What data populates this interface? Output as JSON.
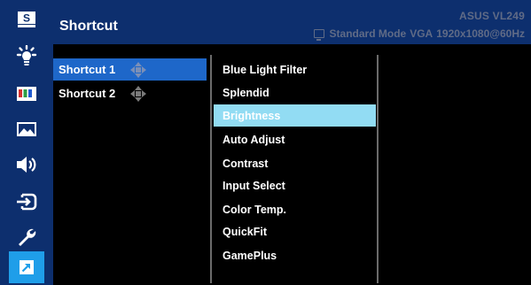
{
  "header": {
    "title": "Shortcut",
    "model": "ASUS  VL249",
    "mode": "Standard Mode",
    "input": "VGA",
    "resolution": "1920x1080@60Hz"
  },
  "sidebar": {
    "items": [
      {
        "name": "splendid-icon"
      },
      {
        "name": "blue-light-filter-icon"
      },
      {
        "name": "color-icon"
      },
      {
        "name": "image-icon"
      },
      {
        "name": "sound-icon"
      },
      {
        "name": "input-select-icon"
      },
      {
        "name": "system-setup-icon"
      },
      {
        "name": "shortcut-icon",
        "active": true
      }
    ]
  },
  "shortcuts": [
    {
      "label": "Shortcut 1",
      "active": true
    },
    {
      "label": "Shortcut 2",
      "active": false
    }
  ],
  "options": [
    {
      "label": "Blue Light Filter"
    },
    {
      "label": "Splendid"
    },
    {
      "label": "Brightness",
      "active": true
    },
    {
      "label": "Auto Adjust"
    },
    {
      "label": "Contrast"
    },
    {
      "label": "Input Select"
    },
    {
      "label": "Color Temp."
    },
    {
      "label": "QuickFit"
    },
    {
      "label": "GamePlus"
    }
  ],
  "colors": {
    "sidebar": "#0d2f6e",
    "accent": "#1f9ee9",
    "selection": "#1e67c9",
    "option_highlight": "#92dcf3",
    "header_secondary_text": "#606b86"
  }
}
